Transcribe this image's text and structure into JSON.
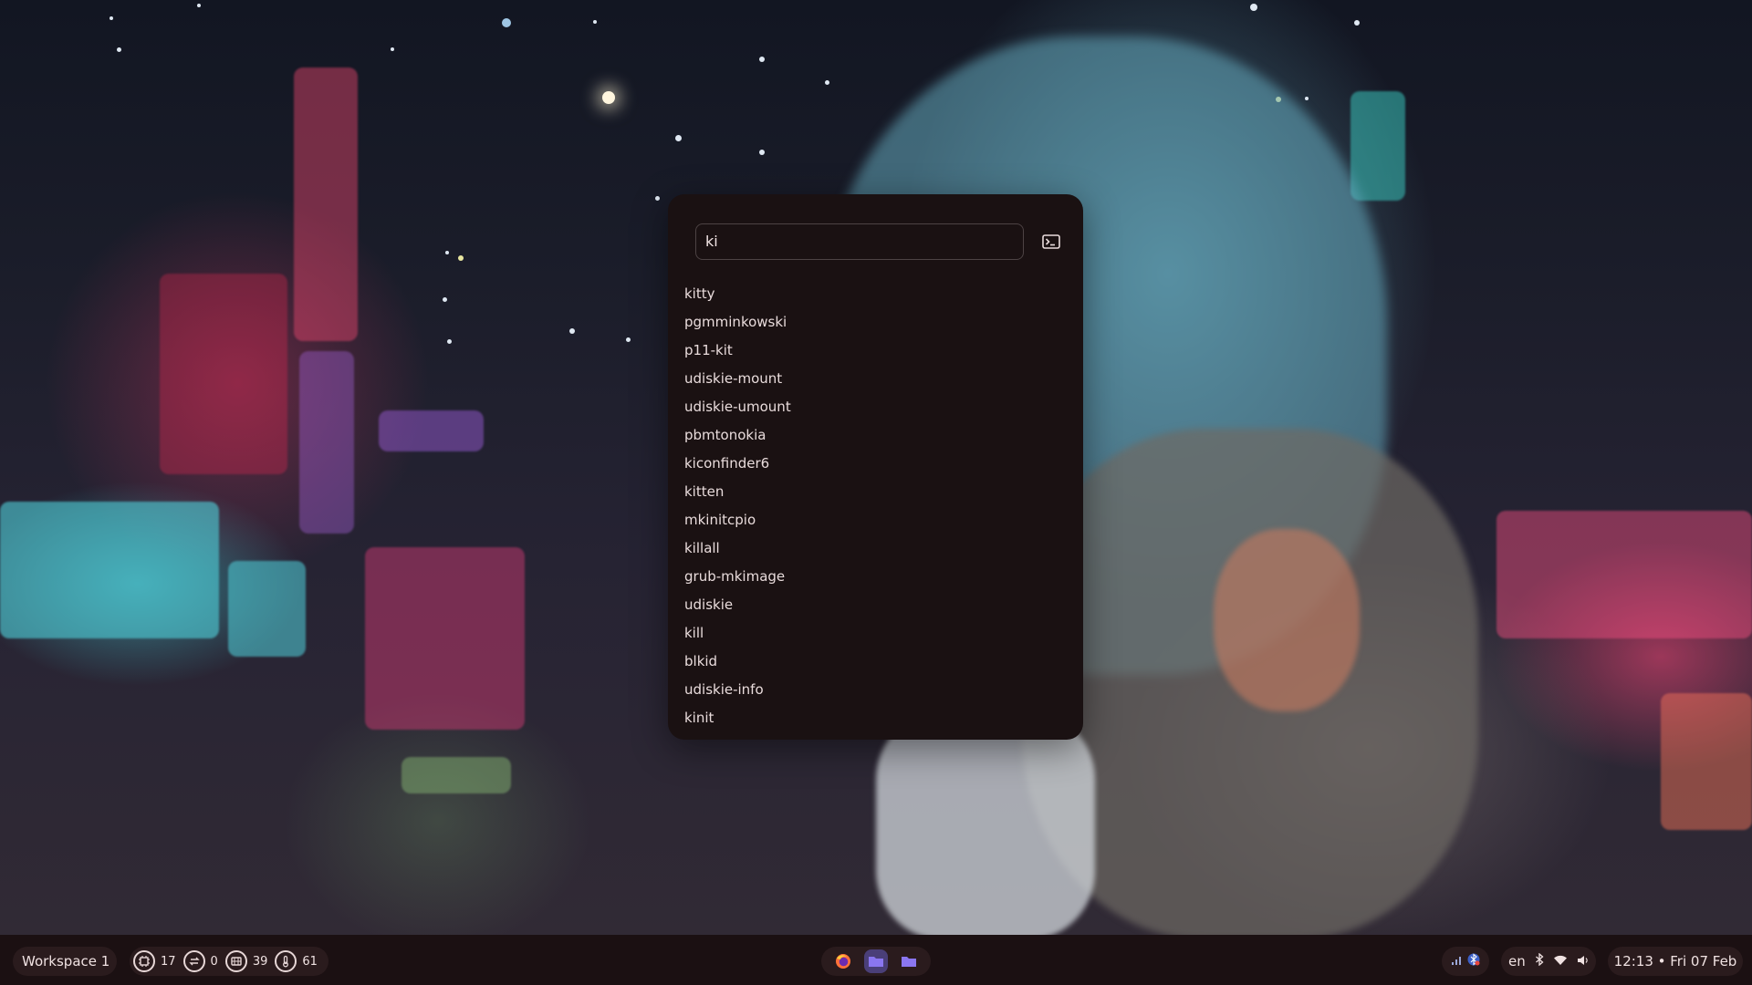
{
  "launcher": {
    "search_value": "ki",
    "terminal_icon": "terminal-icon",
    "results": [
      "kitty",
      "pgmminkowski",
      "p11-kit",
      "udiskie-mount",
      "udiskie-umount",
      "pbmtonokia",
      "kiconfinder6",
      "kitten",
      "mkinitcpio",
      "killall",
      "grub-mkimage",
      "udiskie",
      "kill",
      "blkid",
      "udiskie-info",
      "kinit"
    ]
  },
  "taskbar": {
    "workspace_label": "Workspace 1",
    "stats": [
      {
        "icon": "cpu-icon",
        "value": "17"
      },
      {
        "icon": "swap-icon",
        "value": "0"
      },
      {
        "icon": "memory-icon",
        "value": "39"
      },
      {
        "icon": "temperature-icon",
        "value": "61"
      }
    ],
    "apps": [
      {
        "icon": "firefox-icon"
      },
      {
        "icon": "folder-icon"
      },
      {
        "icon": "folder-icon"
      }
    ],
    "tray": [
      {
        "icon": "signal-bars-icon"
      },
      {
        "icon": "bluetooth-tray-icon"
      }
    ],
    "language": "en",
    "system_icons": [
      "bluetooth-icon",
      "wifi-icon",
      "volume-icon"
    ],
    "clock": "12:13 • Fri 07 Feb"
  },
  "colors": {
    "launcher_bg": "#1a1112",
    "taskbar_bg": "#1b1012",
    "pill_bg": "#2a1b1d",
    "text": "#e9dcdc"
  }
}
